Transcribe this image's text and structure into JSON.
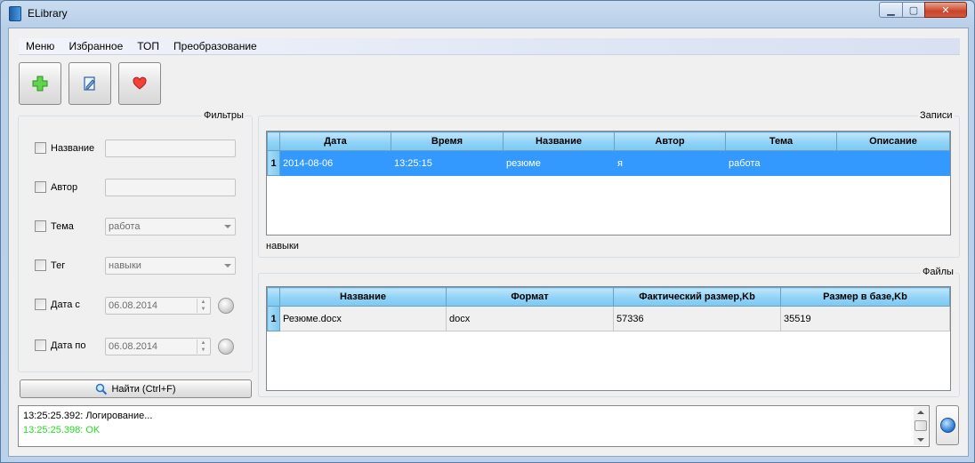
{
  "window": {
    "title": "ELibrary",
    "min_glyph": "▁",
    "max_glyph": "▢",
    "close_glyph": "✕"
  },
  "menu": [
    "Меню",
    "Избранное",
    "ТОП",
    "Преобразование"
  ],
  "toolbar": {
    "add_icon": "plus-icon",
    "edit_icon": "edit-document-icon",
    "favorite_icon": "heart-icon"
  },
  "filters": {
    "title": "Фильтры",
    "name_label": "Название",
    "name_value": "",
    "author_label": "Автор",
    "author_value": "",
    "theme_label": "Тема",
    "theme_value": "работа",
    "tag_label": "Тег",
    "tag_value": "навыки",
    "date_from_label": "Дата с",
    "date_from_value": "06.08.2014",
    "date_to_label": "Дата по",
    "date_to_value": "06.08.2014",
    "spin_up": "▲",
    "spin_down": "▼"
  },
  "find_button": "Найти (Ctrl+F)",
  "records": {
    "title": "Записи",
    "columns": [
      "Дата",
      "Время",
      "Название",
      "Автор",
      "Тема",
      "Описание"
    ],
    "rows": [
      {
        "num": "1",
        "cells": [
          "2014-08-06",
          "13:25:15",
          "резюме",
          "я",
          "работа",
          ""
        ]
      }
    ],
    "tags_text": "навыки"
  },
  "files": {
    "title": "Файлы",
    "columns": [
      "Название",
      "Формат",
      "Фактический размер,Kb",
      "Размер в базе,Kb"
    ],
    "rows": [
      {
        "num": "1",
        "cells": [
          "Резюме.docx",
          "docx",
          "57336",
          "35519"
        ]
      }
    ]
  },
  "log": {
    "lines": [
      {
        "text": "13:25:25.392: Логирование...",
        "color": "#000000"
      },
      {
        "text": "13:25:25.398: OK",
        "color": "#22dd22"
      }
    ]
  },
  "colors": {
    "selection": "#3399ff",
    "header": "#8fd2f6",
    "ok": "#22dd22"
  }
}
